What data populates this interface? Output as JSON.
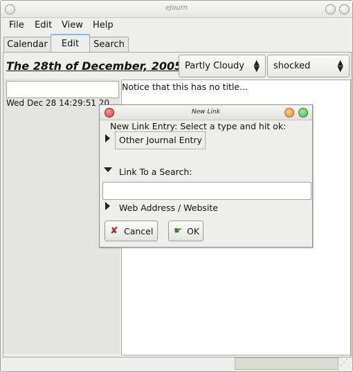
{
  "window": {
    "title": "eJourn"
  },
  "menu": {
    "file": "File",
    "edit": "Edit",
    "view": "View",
    "help": "Help"
  },
  "tabs": {
    "calendar": "Calendar",
    "edit": "Edit",
    "search": "Search"
  },
  "entry": {
    "date_heading": "The 28th of December, 2005",
    "weather": "Partly Cloudy",
    "mood": "shocked",
    "title_value": "",
    "timestamp": "Wed Dec 28 14:29:51 20",
    "body_text": "Notice that this has no title..."
  },
  "dialog": {
    "title": "New Link",
    "instruction": "New Link Entry: Select a type and hit ok:",
    "option_journal": "Other Journal Entry",
    "option_search": "Link To a Search:",
    "search_value": "",
    "option_web": "Web Address / Website",
    "cancel_label": "Cancel",
    "ok_label": "OK"
  },
  "icons": {
    "close": "close-icon",
    "minimize": "minimize-icon",
    "maximize": "maximize-icon",
    "cancel": "cancel-x-icon",
    "ok": "ok-hand-icon",
    "expand": "triangle-right-icon",
    "collapse": "triangle-down-icon",
    "combo_arrows": "up-down-arrows-icon"
  },
  "colors": {
    "dialog_close": "#d93a3a",
    "dialog_min": "#e8912e",
    "dialog_max": "#4bb54b",
    "tab_active_accent": "#8fb5e1"
  }
}
